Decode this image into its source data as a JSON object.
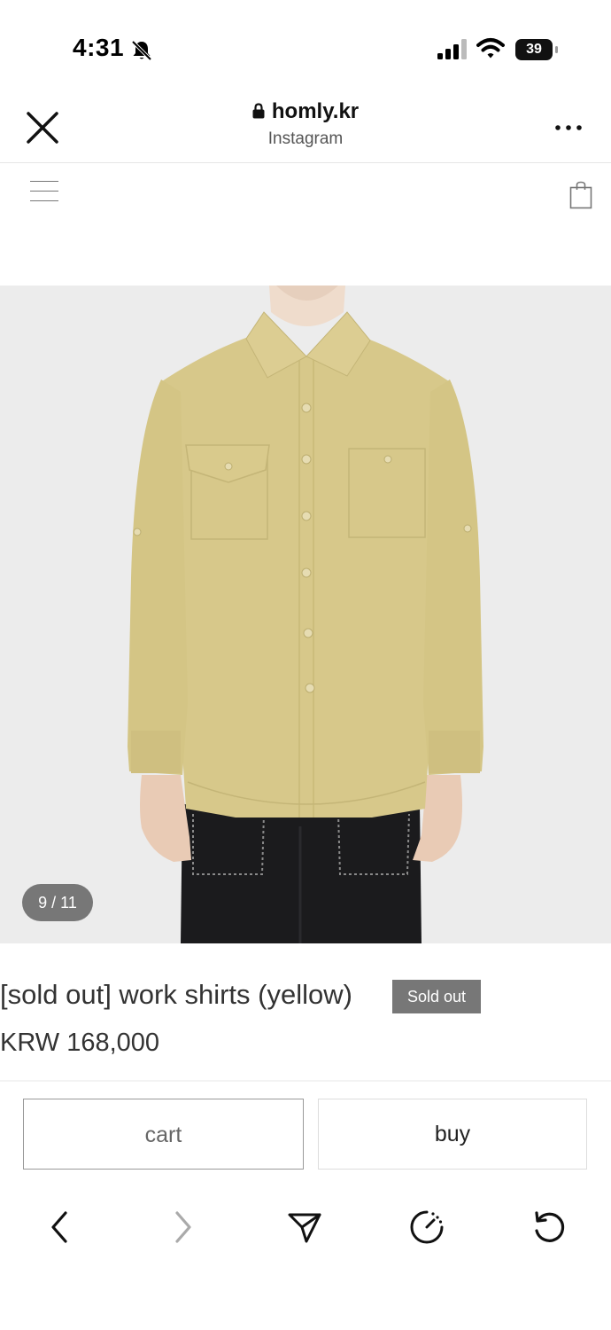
{
  "status_bar": {
    "time": "4:31",
    "battery": "39"
  },
  "browser": {
    "domain": "homly.kr",
    "subtitle": "Instagram"
  },
  "gallery": {
    "counter": "9 / 11"
  },
  "product": {
    "title": "[sold out] work shirts (yellow)",
    "badge": "Sold out",
    "price": "KRW 168,000"
  },
  "actions": {
    "cart_label": "cart",
    "buy_label": "buy"
  },
  "colors": {
    "shirt": "#d7c88a",
    "pants": "#1b1b1d",
    "badge_bg": "#777777",
    "image_bg": "#ececec"
  },
  "icons": {
    "status": [
      "bell-slash-icon",
      "signal-icon",
      "wifi-icon",
      "battery-icon"
    ],
    "header": [
      "close-icon",
      "lock-icon",
      "more-icon"
    ],
    "nav": [
      "menu-icon",
      "shopping-bag-icon"
    ],
    "toolbar": [
      "back-icon",
      "forward-icon",
      "share-icon",
      "speed-icon",
      "reload-icon"
    ]
  }
}
